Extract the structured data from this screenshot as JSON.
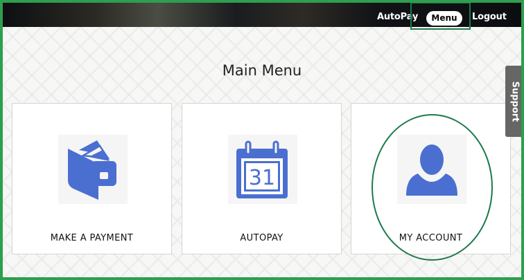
{
  "nav": {
    "autopay_label": "AutoPay",
    "menu_label": "Menu",
    "logout_label": "Logout"
  },
  "page": {
    "title": "Main Menu"
  },
  "cards": [
    {
      "label": "MAKE A PAYMENT",
      "icon": "wallet-icon"
    },
    {
      "label": "AUTOPAY",
      "icon": "calendar-icon",
      "icon_text": "31"
    },
    {
      "label": "MY ACCOUNT",
      "icon": "user-icon"
    }
  ],
  "support": {
    "label": "Support"
  },
  "colors": {
    "icon_blue": "#4a6fd1",
    "highlight_green": "#1c7a4c",
    "frame_green": "#2e9e4f",
    "support_gray": "#666666"
  }
}
